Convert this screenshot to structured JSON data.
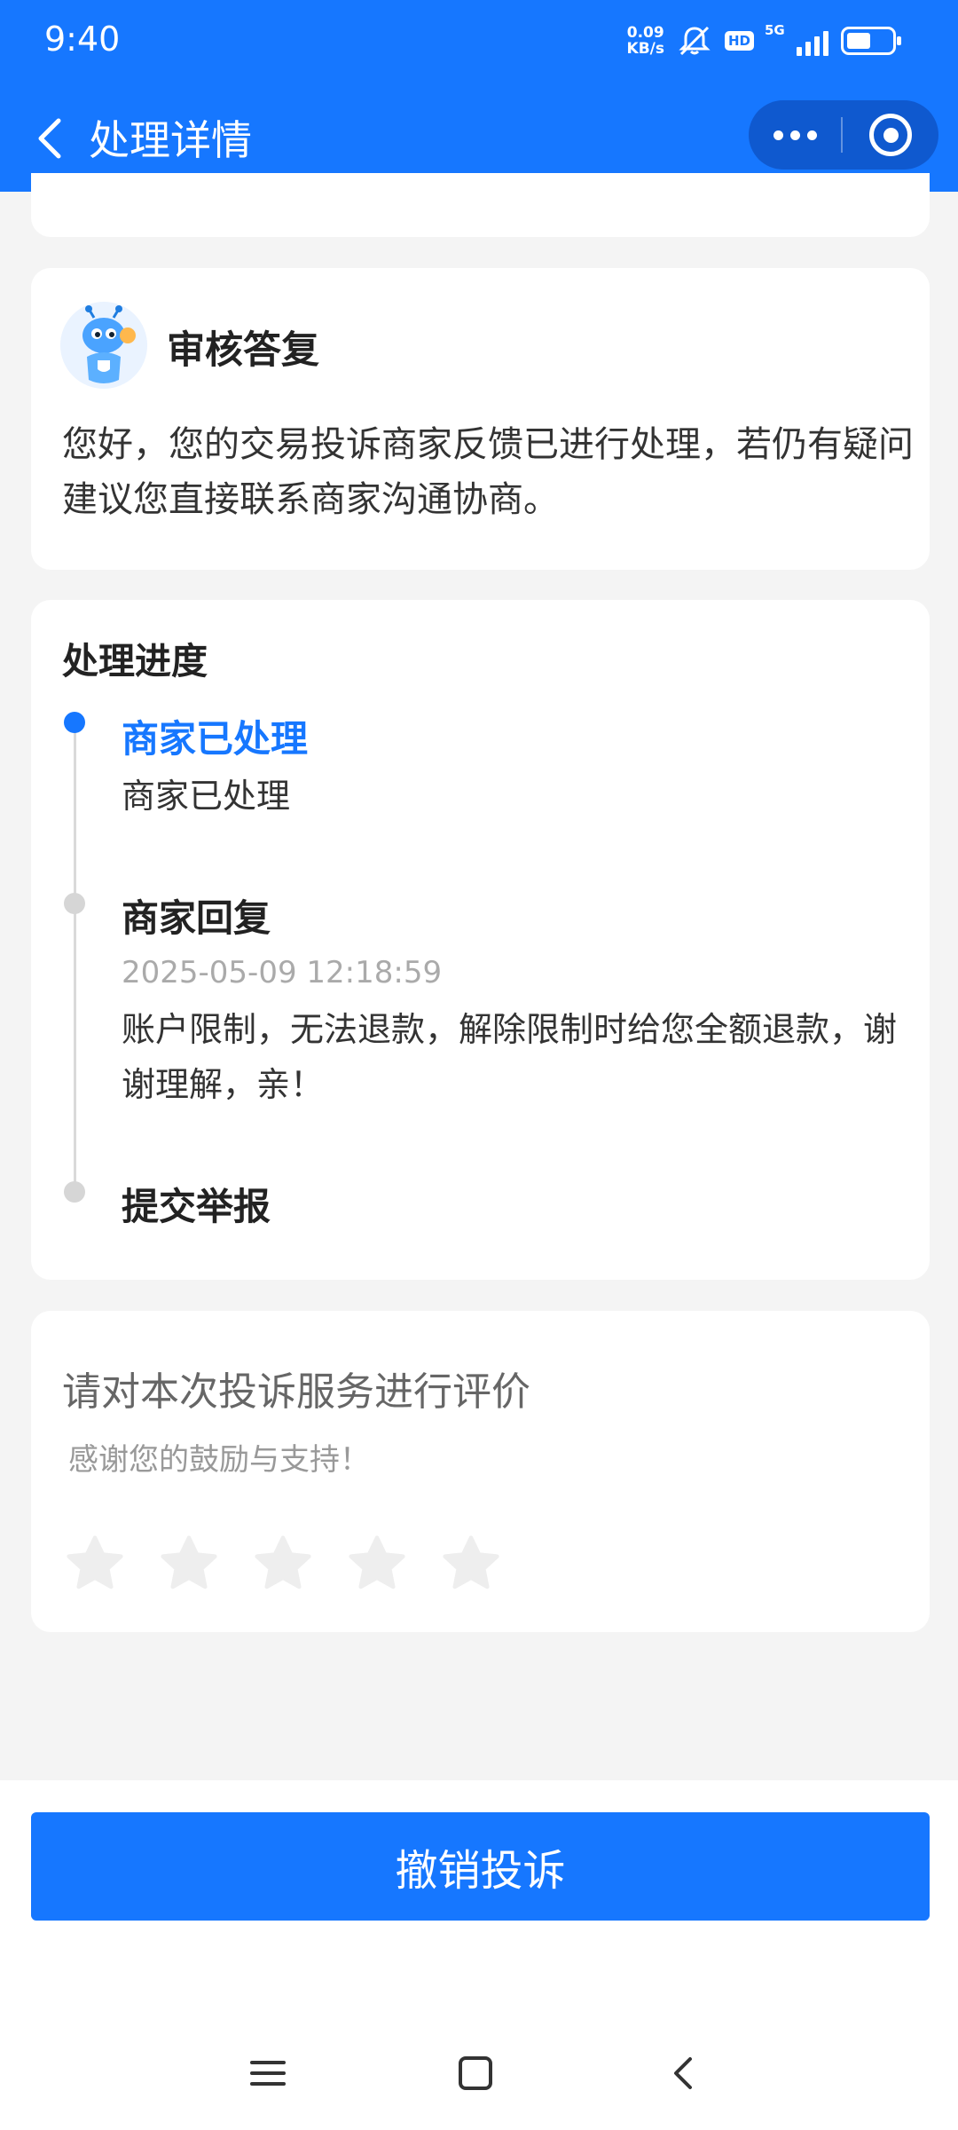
{
  "status_bar": {
    "time": "9:40",
    "net_speed_value": "0.09",
    "net_speed_unit": "KB/s",
    "hd": "HD",
    "network": "5G"
  },
  "nav": {
    "title": "处理详情"
  },
  "reply": {
    "title": "审核答复",
    "text": "您好，您的交易投诉商家反馈已进行处理，若仍有疑问建议您直接联系商家沟通协商。"
  },
  "progress": {
    "title": "处理进度",
    "steps": [
      {
        "title": "商家已处理",
        "desc": "商家已处理"
      },
      {
        "title": "商家回复",
        "time": "2025-05-09 12:18:59",
        "desc": "账户限制，无法退款，解除限制时给您全额退款，谢谢理解，亲！"
      },
      {
        "title": "提交举报"
      }
    ]
  },
  "rating": {
    "title": "请对本次投诉服务进行评价",
    "subtitle": "感谢您的鼓励与支持！",
    "stars_selected": 0,
    "stars_total": 5
  },
  "actions": {
    "revoke_label": "撤销投诉"
  },
  "colors": {
    "brand": "#1677ff",
    "star_empty": "#eeeeee"
  }
}
